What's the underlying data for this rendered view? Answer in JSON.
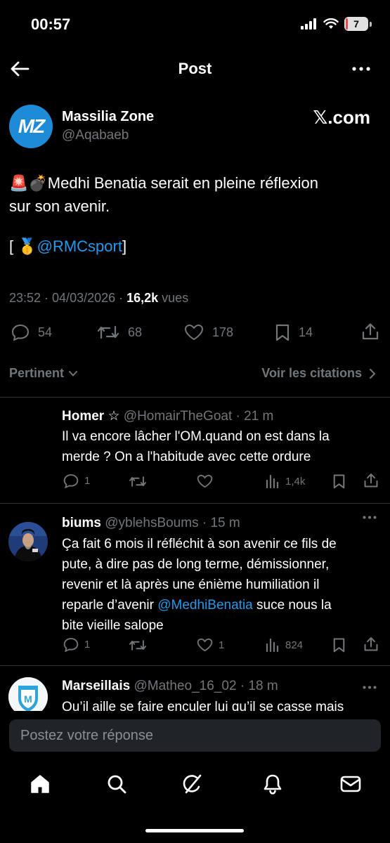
{
  "status_bar": {
    "time": "00:57",
    "battery": "7",
    "battery_level": 0.07
  },
  "header": {
    "title": "Post",
    "back_icon": "arrow-left-icon",
    "more_icon": "more-horizontal-icon"
  },
  "post": {
    "avatar_text": "MZ",
    "author_name": "Massilia Zone",
    "author_handle": "@Aqabaeb",
    "source": "𝕏.com",
    "text_line1": "🚨💣Medhi Benatia serait en pleine réflexion",
    "text_line2": "sur son avenir.",
    "credit_prefix": "[ 🥇",
    "credit_link": "@RMCsport",
    "credit_suffix": "]",
    "time": "23:52 · 04/03/2026 · ",
    "views_count": "16,2k",
    "views_label": " vues",
    "replies": "54",
    "reposts": "68",
    "likes": "178",
    "bookmarks": "14"
  },
  "filters": {
    "sort_label": "Pertinent",
    "quotes_label": "Voir les citations"
  },
  "replies": [
    {
      "name": "Homer ☆",
      "handle": "@HomairTheGoat",
      "time": " · 21 m",
      "line1": "Il va encore lâcher l'OM.quand on est dans la",
      "line2": "merde ? On a l'habitude avec cette ordure",
      "replies": "1",
      "reposts": "",
      "likes": "",
      "views": "1,4k"
    },
    {
      "name": "biums",
      "handle": "@yblehsBoums",
      "time": " · 15 m",
      "line1": "Ça fait 6 mois il réfléchit à son avenir ce fils de",
      "line2": "pute, à dire pas de long terme, démissionner,",
      "line3": "revenir et là après une énième humiliation il",
      "line4_prefix": "reparle d’avenir ",
      "line4_link": "@MedhiBenatia",
      "line4_suffix": " suce nous la",
      "line5": "bite vieille salope",
      "replies": "1",
      "reposts": "",
      "likes": "1",
      "views": "824"
    },
    {
      "name": "Marseillais",
      "handle": "@Matheo_16_02",
      "time": " · 18 m",
      "line1": "Qu’il aille se faire enculer lui qu’il se casse mais"
    }
  ],
  "composer": {
    "placeholder": "Postez votre réponse"
  },
  "nav": [
    "home-icon",
    "search-icon",
    "grok-icon",
    "notifications-icon",
    "messages-icon"
  ],
  "colors": {
    "background": "#000000",
    "link": "#1d9bf0",
    "muted": "#71767b",
    "divider": "#2f3336",
    "avatar_brand": "#1d8bd8"
  }
}
